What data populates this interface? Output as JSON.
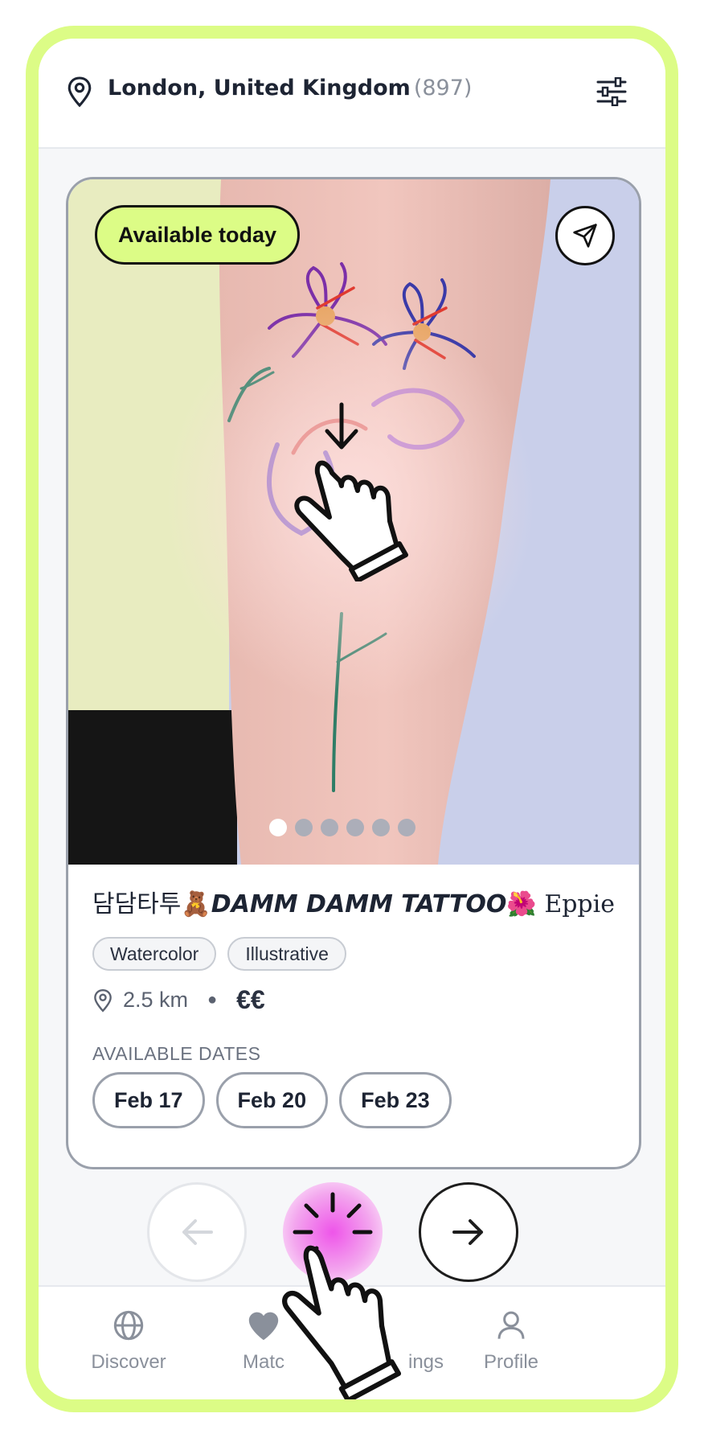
{
  "header": {
    "location": "London, United Kingdom",
    "count": "(897)"
  },
  "card": {
    "badge": "Available today",
    "carousel": {
      "total": 6,
      "active": 0
    },
    "title_ko": "담담타투🧸",
    "title_main": "DAMM DAMM TATTOO",
    "title_emoji": "🌺",
    "artist": "Eppie",
    "tags": [
      "Watercolor",
      "Illustrative"
    ],
    "distance": "2.5 km",
    "price": "€€",
    "dates_label": "AVAILABLE DATES",
    "dates": [
      "Feb 17",
      "Feb 20",
      "Feb 23"
    ]
  },
  "tabs": {
    "discover": "Discover",
    "matches": "Matc",
    "bookings": "ings",
    "profile": "Profile"
  },
  "colors": {
    "accent": "#dcfc86",
    "like": "#ee55e9"
  }
}
